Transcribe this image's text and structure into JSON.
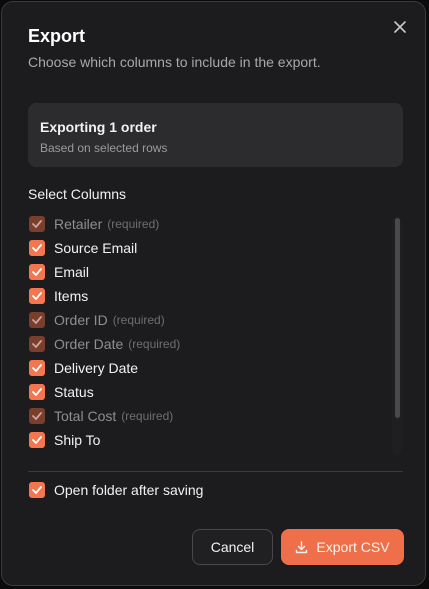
{
  "dialog": {
    "title": "Export",
    "subtitle": "Choose which columns to include in the export.",
    "close_icon": "close-icon"
  },
  "summary": {
    "title": "Exporting 1 order",
    "subtitle": "Based on selected rows"
  },
  "columns_section": {
    "label": "Select Columns",
    "items": [
      {
        "label": "Retailer",
        "required_note": "(required)",
        "checked": true,
        "disabled": true
      },
      {
        "label": "Source Email",
        "required_note": "",
        "checked": true,
        "disabled": false
      },
      {
        "label": "Email",
        "required_note": "",
        "checked": true,
        "disabled": false
      },
      {
        "label": "Items",
        "required_note": "",
        "checked": true,
        "disabled": false
      },
      {
        "label": "Order ID",
        "required_note": "(required)",
        "checked": true,
        "disabled": true
      },
      {
        "label": "Order Date",
        "required_note": "(required)",
        "checked": true,
        "disabled": true
      },
      {
        "label": "Delivery Date",
        "required_note": "",
        "checked": true,
        "disabled": false
      },
      {
        "label": "Status",
        "required_note": "",
        "checked": true,
        "disabled": false
      },
      {
        "label": "Total Cost",
        "required_note": "(required)",
        "checked": true,
        "disabled": true
      },
      {
        "label": "Ship To",
        "required_note": "",
        "checked": true,
        "disabled": false
      }
    ]
  },
  "options": {
    "open_folder_label": "Open folder after saving",
    "open_folder_checked": true
  },
  "footer": {
    "cancel_label": "Cancel",
    "export_label": "Export CSV",
    "export_icon": "download-icon"
  },
  "colors": {
    "accent": "#f4764e",
    "accent_disabled": "#7a3e2c",
    "background": "#1c1c1e",
    "card": "#2c2c2e"
  }
}
